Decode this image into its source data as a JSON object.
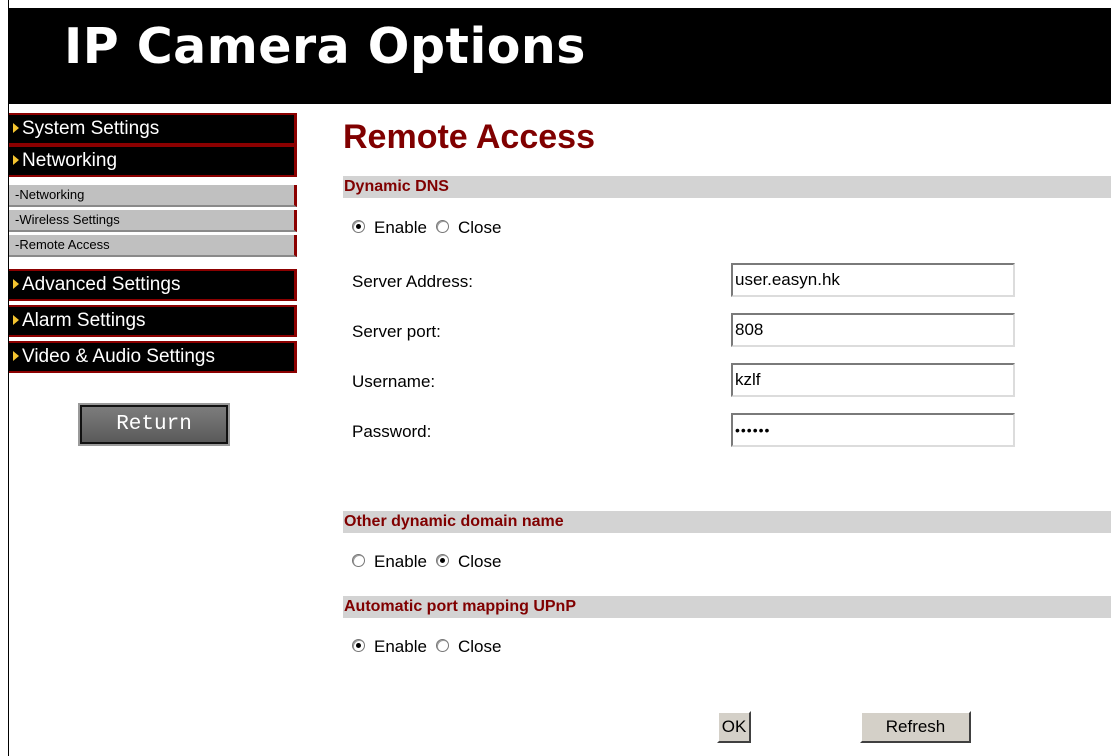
{
  "header": {
    "title": "IP Camera Options"
  },
  "sidebar": {
    "main_items": [
      {
        "label": "System Settings"
      },
      {
        "label": "Networking"
      },
      {
        "label": "Advanced Settings"
      },
      {
        "label": "Alarm Settings"
      },
      {
        "label": "Video & Audio Settings"
      }
    ],
    "sub_items": [
      {
        "label": "-Networking"
      },
      {
        "label": "-Wireless Settings"
      },
      {
        "label": "-Remote Access"
      }
    ],
    "return_label": "Return"
  },
  "main": {
    "title": "Remote Access",
    "ddns": {
      "heading": "Dynamic DNS",
      "enable_label": "Enable",
      "close_label": "Close",
      "selected": "Enable",
      "fields": [
        {
          "label": "Server Address:",
          "value": "user.easyn.hk"
        },
        {
          "label": "Server port:",
          "value": "808"
        },
        {
          "label": "Username:",
          "value": "kzlf"
        },
        {
          "label": "Password:",
          "value": "••••••"
        }
      ]
    },
    "other_ddns": {
      "heading": "Other dynamic domain name",
      "enable_label": "Enable",
      "close_label": "Close",
      "selected": "Close"
    },
    "upnp": {
      "heading": "Automatic port mapping UPnP",
      "enable_label": "Enable",
      "close_label": "Close",
      "selected": "Enable"
    },
    "buttons": {
      "ok": "OK",
      "refresh": "Refresh"
    }
  }
}
